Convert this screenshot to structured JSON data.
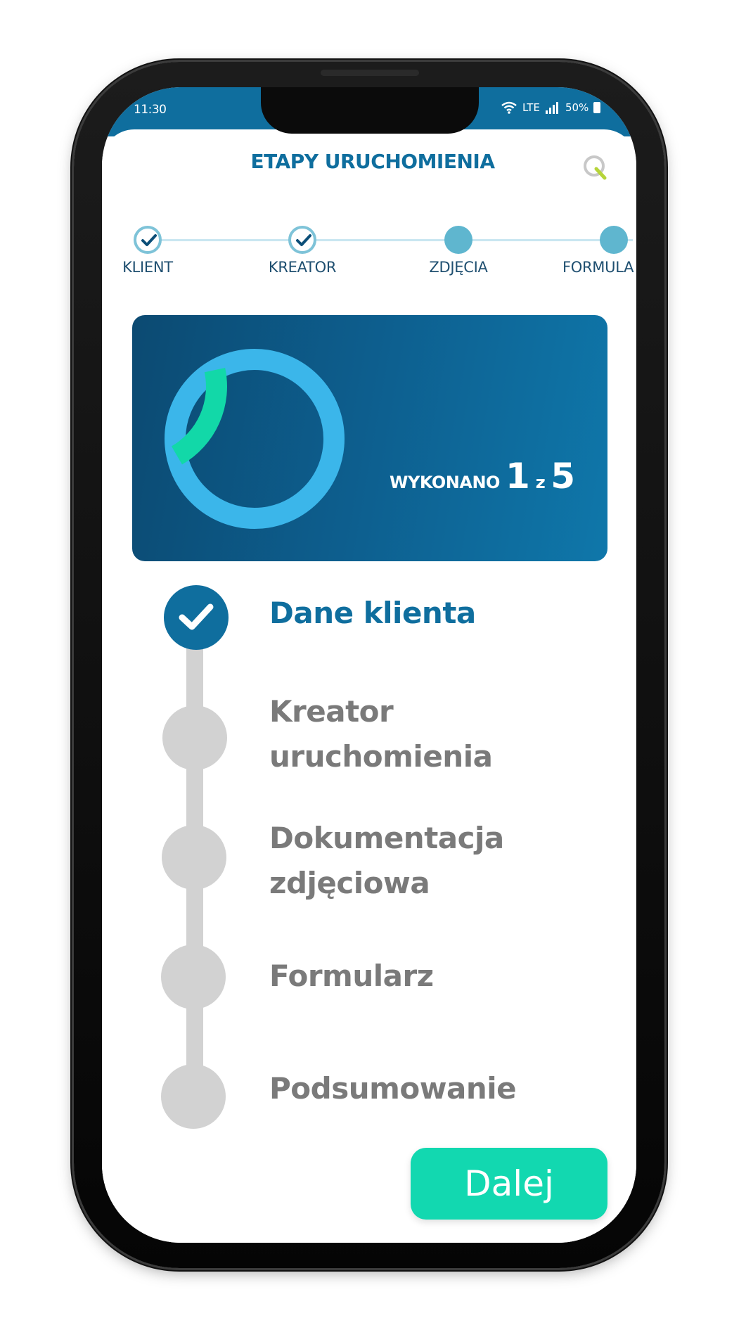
{
  "status_bar": {
    "time": "11:30",
    "network": "LTE",
    "battery": "50%",
    "icons": [
      "wifi-icon",
      "signal-icon",
      "battery-icon"
    ]
  },
  "header": {
    "title": "ETAPY URUCHOMIENIA",
    "logo_icon": "q-logo-icon"
  },
  "stepper": {
    "steps": [
      {
        "label": "KLIENT",
        "done": true
      },
      {
        "label": "KREATOR",
        "done": true
      },
      {
        "label": "ZDJĘCIA",
        "done": false
      },
      {
        "label": "FORMULA",
        "done": false
      }
    ]
  },
  "progress": {
    "label": "WYKONANO",
    "done": "1",
    "separator": "z",
    "total": "5",
    "fraction": 0.2
  },
  "stages": [
    {
      "lines": [
        "Dane klienta"
      ],
      "done": true
    },
    {
      "lines": [
        "Kreator",
        "uruchomienia"
      ],
      "done": false
    },
    {
      "lines": [
        "Dokumentacja",
        "zdjęciowa"
      ],
      "done": false
    },
    {
      "lines": [
        "Formularz"
      ],
      "done": false
    },
    {
      "lines": [
        "Podsumowanie"
      ],
      "done": false
    }
  ],
  "next_button": {
    "label": "Dalej"
  },
  "colors": {
    "brand": "#0f6e9e",
    "accent": "#12d8b0",
    "ring": "#3bb6ea",
    "pending": "#d2d2d2"
  }
}
